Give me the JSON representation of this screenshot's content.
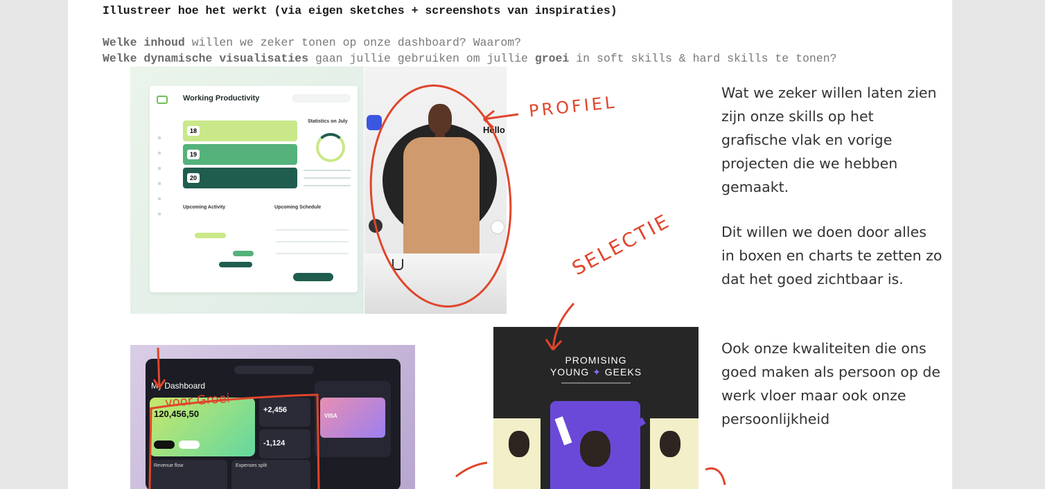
{
  "heading": "Illustreer hoe het werkt (via eigen sketches + screenshots van inspiraties)",
  "question1": {
    "a": "Welke",
    "b": "inhoud",
    "c": " willen we zeker tonen op onze dashboard? Waarom?"
  },
  "question2": {
    "a": "Welke",
    "b": "dynamische visualisaties",
    "c": " gaan jullie gebruiken om jullie ",
    "d": "groei",
    "e": " in soft skills & hard skills te tonen?"
  },
  "paragraphs": [
    "Wat we zeker willen laten zien zijn onze skills op het grafische vlak en vorige projecten die we hebben gemaakt.",
    "Dit willen we doen door alles in boxen en charts te zetten zo dat het goed zichtbaar is.",
    "Ook onze kwaliteiten die ons goed maken als persoon op de werk vloer maar ook onze persoonlijkheid"
  ],
  "annotations": {
    "profiel": "PROFIEL",
    "selectie": "SELECTIE",
    "groei": "voor Groei"
  },
  "dashboard1": {
    "title": "Working Productivity",
    "stats_title": "Statistics on July",
    "upcoming_activity": "Upcoming Activity",
    "upcoming_schedule": "Upcoming Schedule",
    "days": [
      "18",
      "19",
      "20"
    ]
  },
  "profile": {
    "hello": "Hello"
  },
  "dashboard2": {
    "title": "My Dashboard",
    "balance": "120,456,50",
    "stat1": "+2,456",
    "stat2": "-1,124",
    "card": "VISA",
    "revenue": "Revenue flow",
    "expenses": "Expenses split"
  },
  "poster": {
    "line1": "PROMISING",
    "line2": "YOUNG",
    "line3": "GEEKS"
  },
  "colors": {
    "accent": "#e0452b",
    "green_dark": "#1f5d4e",
    "green_light": "#c9e88a",
    "purple": "#6a49d8"
  }
}
